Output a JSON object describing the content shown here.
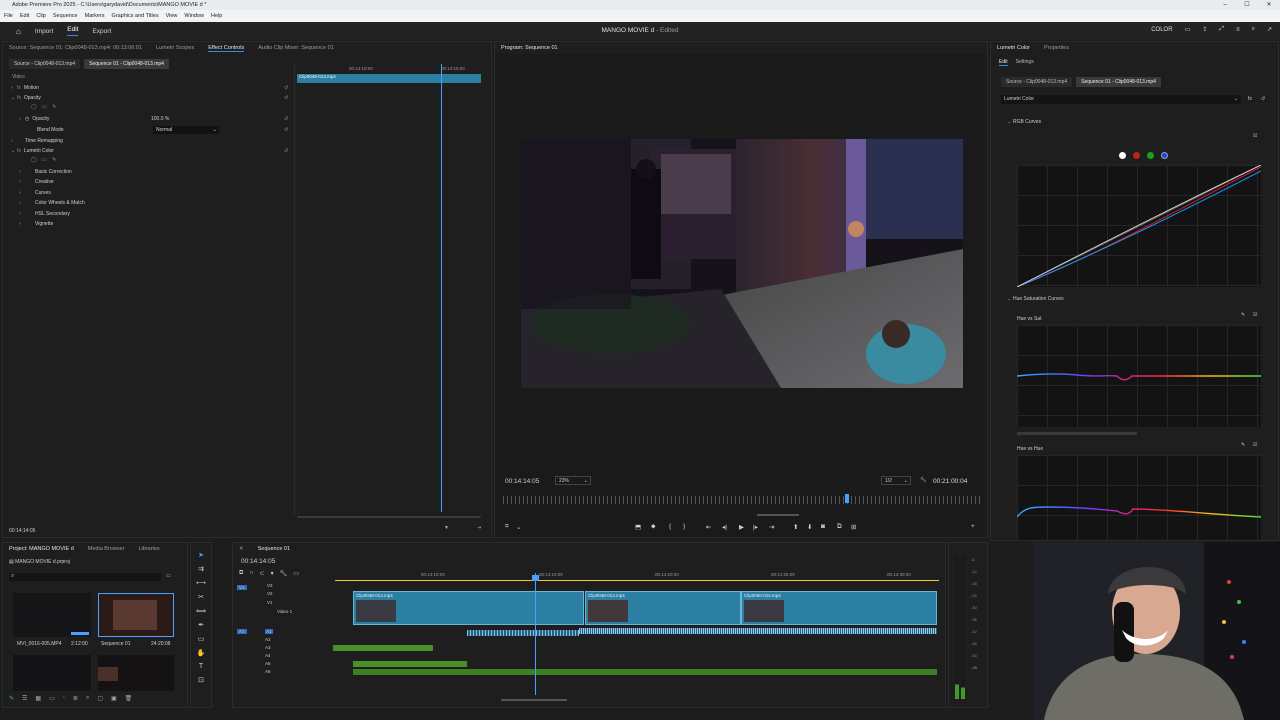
{
  "app": {
    "window_title": "Adobe Premiere Pro 2025 - C:\\Users\\garydavid\\Documents\\MANGO MOVIE d *",
    "menu": [
      "File",
      "Edit",
      "Clip",
      "Sequence",
      "Markers",
      "Graphics and Titles",
      "View",
      "Window",
      "Help"
    ],
    "workspace_tabs": [
      "Import",
      "Edit",
      "Export"
    ],
    "active_tab": "Edit",
    "project_title": "MANGO MOVIE d",
    "edited_status": "- Edited",
    "color_label": "COLOR"
  },
  "effect_controls": {
    "tabs": [
      "Source: Sequence 01: Clip0048-013.mp4: 00:13:06:01",
      "Lumetri Scopes",
      "Effect Controls",
      "Audio Clip Mixer: Sequence 01"
    ],
    "source_chip": "Source - Clip0048-013.mp4",
    "seq_chip": "Sequence 01 - Clip0048-013.mp4",
    "section": "Video",
    "rows": {
      "motion": "Motion",
      "opacity": "Opacity",
      "opacity_sub": "Opacity",
      "opacity_value": "100.0 %",
      "blend_mode": "Blend Mode",
      "blend_value": "Normal",
      "time_remapping": "Time Remapping",
      "lumetri": "Lumetri Color",
      "basic": "Basic Correction",
      "creative": "Creative",
      "curves": "Curves",
      "wheels": "Color Wheels & Match",
      "hsl": "HSL Secondary",
      "vignette": "Vignette"
    },
    "mini_ruler_1": "00:14:10:00",
    "mini_ruler_2": "00:14:15:00",
    "mini_clip": "Clip0048-013.mp4",
    "timecode": "00:14:14:05"
  },
  "program": {
    "tab": "Program: Sequence 01",
    "timecode": "00:14:14:05",
    "zoom": "23%",
    "quality": "1/2",
    "duration": "00:21:00:04"
  },
  "lumetri_panel": {
    "tabs": [
      "Lumetri Color",
      "Properties"
    ],
    "subtabs": [
      "Edit",
      "Settings"
    ],
    "source_chip": "Source - Clip0048-013.mp4",
    "seq_chip": "Sequence 01 - Clip0048-013.mp4",
    "effect_select": "Lumetri Color",
    "rgb_curves": "RGB Curves",
    "hue_sat_curves": "Hue Saturation Curves",
    "hue_vs_sat": "Hue vs Sat",
    "hue_vs_hue": "Hue vs Hue"
  },
  "project": {
    "tabs": [
      "Project: MANGO MOVIE d",
      "Media Browser",
      "Libraries"
    ],
    "file": "MANGO MOVIE d.prproj",
    "items": [
      {
        "name": "MVI_0016-005.MP4",
        "duration": "2:12:00"
      },
      {
        "name": "Sequence 01",
        "duration": "24:20:08"
      }
    ]
  },
  "timeline": {
    "tab": "Sequence 01",
    "timecode": "00:14:14:05",
    "ruler": [
      "00:14:10:00",
      "00:14:15:00",
      "00:14:20:00",
      "00:14:25:00",
      "00:14:30:00"
    ],
    "tracks": [
      "V3",
      "V2",
      "V1",
      "A1",
      "A2",
      "A3",
      "A4",
      "A5",
      "A6"
    ],
    "video_track_name": "Video 1",
    "clips": [
      {
        "name": "Clip0048-013.mp4"
      },
      {
        "name": "Clip0048-013.mp4"
      },
      {
        "name": "Clip0050-010.mp4"
      }
    ],
    "meter_scale": [
      "-6",
      "-12",
      "-18",
      "-24",
      "-30",
      "-36",
      "-42",
      "-48",
      "-54",
      "-dB"
    ]
  },
  "colors": {
    "accent": "#2d8ceb",
    "clip": "#2a7fa3",
    "audio_green": "#4a8f2a"
  }
}
